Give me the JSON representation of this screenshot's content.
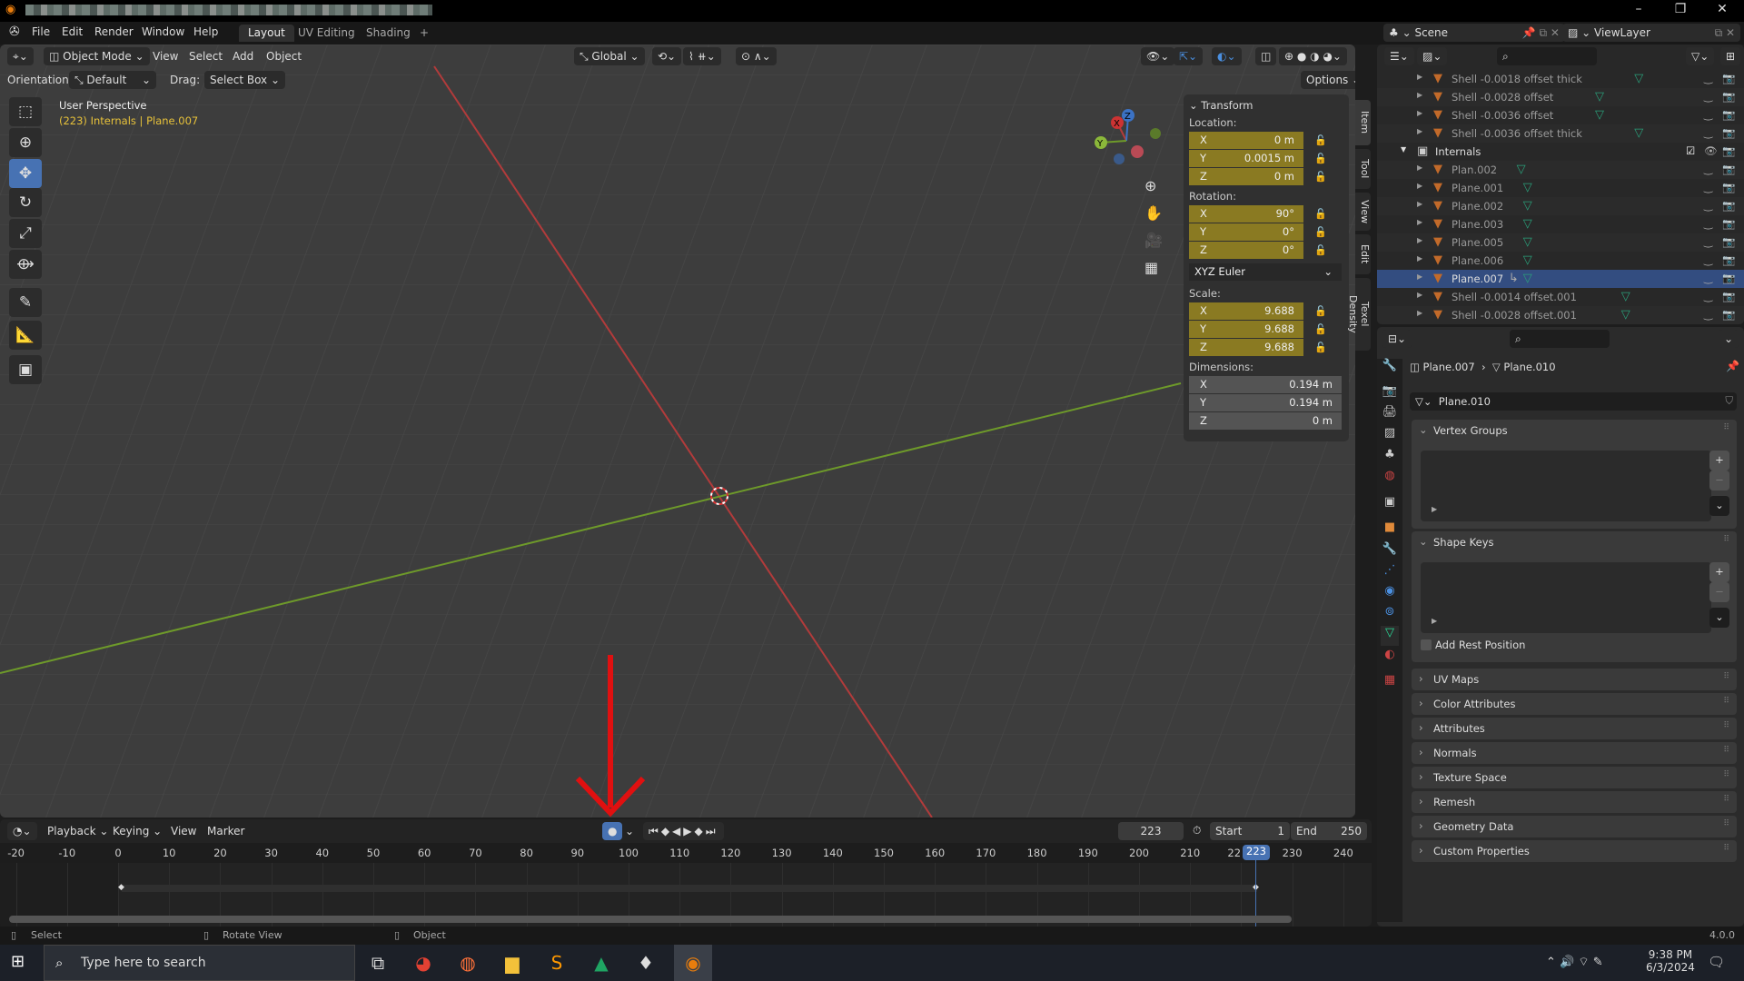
{
  "window": {
    "controls": [
      "minimize-icon",
      "restore-icon",
      "close-icon"
    ]
  },
  "topbar": {
    "menus": [
      "File",
      "Edit",
      "Render",
      "Window",
      "Help"
    ],
    "workspaces": [
      "Layout",
      "UV Editing",
      "Shading"
    ],
    "active_workspace": "Layout",
    "add_workspace": "+"
  },
  "viewport": {
    "mode": "Object Mode",
    "menus": [
      "View",
      "Select",
      "Add",
      "Object"
    ],
    "transform_orientation": "Global",
    "tool_settings": {
      "orientation_label": "Orientation:",
      "orientation": "Default",
      "drag_label": "Drag:",
      "drag": "Select Box",
      "options": "Options"
    },
    "overlay_title": "User Perspective",
    "overlay_subtitle": "(223) Internals | Plane.007",
    "gizmo": {
      "x": "X",
      "y": "Y",
      "z": "Z"
    },
    "tools": [
      "select-box-icon",
      "cursor-icon",
      "move-icon",
      "rotate-icon",
      "scale-icon",
      "transform-icon",
      "annotate-icon",
      "measure-icon",
      "add-cube-icon"
    ],
    "active_tool": "move-icon",
    "colors": {
      "x_axis": "#b23b3b",
      "y_axis": "#6e9a2a",
      "active_field": "#8a7a22",
      "selection": "#4772b3"
    }
  },
  "n_panel": {
    "title": "Transform",
    "location_label": "Location:",
    "location": [
      {
        "axis": "X",
        "value": "0 m"
      },
      {
        "axis": "Y",
        "value": "0.0015 m"
      },
      {
        "axis": "Z",
        "value": "0 m"
      }
    ],
    "rotation_label": "Rotation:",
    "rotation": [
      {
        "axis": "X",
        "value": "90°"
      },
      {
        "axis": "Y",
        "value": "0°"
      },
      {
        "axis": "Z",
        "value": "0°"
      }
    ],
    "rotation_mode": "XYZ Euler",
    "scale_label": "Scale:",
    "scale": [
      {
        "axis": "X",
        "value": "9.688"
      },
      {
        "axis": "Y",
        "value": "9.688"
      },
      {
        "axis": "Z",
        "value": "9.688"
      }
    ],
    "dimensions_label": "Dimensions:",
    "dimensions": [
      {
        "axis": "X",
        "value": "0.194 m"
      },
      {
        "axis": "Y",
        "value": "0.194 m"
      },
      {
        "axis": "Z",
        "value": "0 m"
      }
    ],
    "tabs": [
      "Item",
      "Tool",
      "View",
      "Edit",
      "Texel Density"
    ],
    "active_tab": "Item"
  },
  "header_right": {
    "scene": "Scene",
    "view_layer": "ViewLayer"
  },
  "outliner": {
    "rows": [
      {
        "name": "Shell -0.0018 offset thick",
        "indent": 1
      },
      {
        "name": "Shell -0.0028 offset",
        "indent": 1
      },
      {
        "name": "Shell -0.0036 offset",
        "indent": 1
      },
      {
        "name": "Shell -0.0036 offset thick",
        "indent": 1
      },
      {
        "name": "Internals",
        "indent": 0,
        "collection": true
      },
      {
        "name": "Plan.002",
        "indent": 1
      },
      {
        "name": "Plane.001",
        "indent": 1
      },
      {
        "name": "Plane.002",
        "indent": 1
      },
      {
        "name": "Plane.003",
        "indent": 1
      },
      {
        "name": "Plane.005",
        "indent": 1
      },
      {
        "name": "Plane.006",
        "indent": 1
      },
      {
        "name": "Plane.007",
        "indent": 1,
        "selected": true
      },
      {
        "name": "Shell -0.0014 offset.001",
        "indent": 1
      },
      {
        "name": "Shell -0.0028 offset.001",
        "indent": 1
      }
    ]
  },
  "properties": {
    "object": "Plane.007",
    "data": "Plane.010",
    "mesh_name": "Plane.010",
    "vertex_groups": "Vertex Groups",
    "shape_keys": "Shape Keys",
    "add_rest_position": "Add Rest Position",
    "panels": [
      "UV Maps",
      "Color Attributes",
      "Attributes",
      "Normals",
      "Texture Space",
      "Remesh",
      "Geometry Data",
      "Custom Properties"
    ],
    "tabs": [
      "tool-icon",
      "render-icon",
      "output-icon",
      "view-layer-icon",
      "scene-icon",
      "world-icon",
      "collection-icon",
      "object-icon",
      "modifier-icon",
      "particles-icon",
      "physics-icon",
      "constraints-icon",
      "mesh-data-icon",
      "material-icon",
      "texture-icon"
    ],
    "active_tab": "mesh-data-icon"
  },
  "timeline": {
    "menus": [
      "Playback",
      "Keying",
      "View",
      "Marker"
    ],
    "current_frame": "223",
    "start_label": "Start",
    "start": "1",
    "end_label": "End",
    "end": "250",
    "ticks": [
      "-20",
      "-10",
      "0",
      "10",
      "20",
      "30",
      "40",
      "50",
      "60",
      "70",
      "80",
      "90",
      "100",
      "110",
      "120",
      "130",
      "140",
      "150",
      "160",
      "170",
      "180",
      "190",
      "200",
      "210",
      "220",
      "230",
      "240"
    ]
  },
  "status": {
    "items": [
      "Select",
      "Rotate View",
      "Object"
    ],
    "version": "4.0.0"
  },
  "taskbar": {
    "search_placeholder": "Type here to search",
    "time": "9:38 PM",
    "date": "6/3/2024",
    "apps": [
      "task-view-icon",
      "chrome-icon",
      "firefox-icon",
      "file-explorer-icon",
      "sublime-text-icon",
      "google-drive-icon",
      "inkscape-icon",
      "blender-icon"
    ]
  }
}
